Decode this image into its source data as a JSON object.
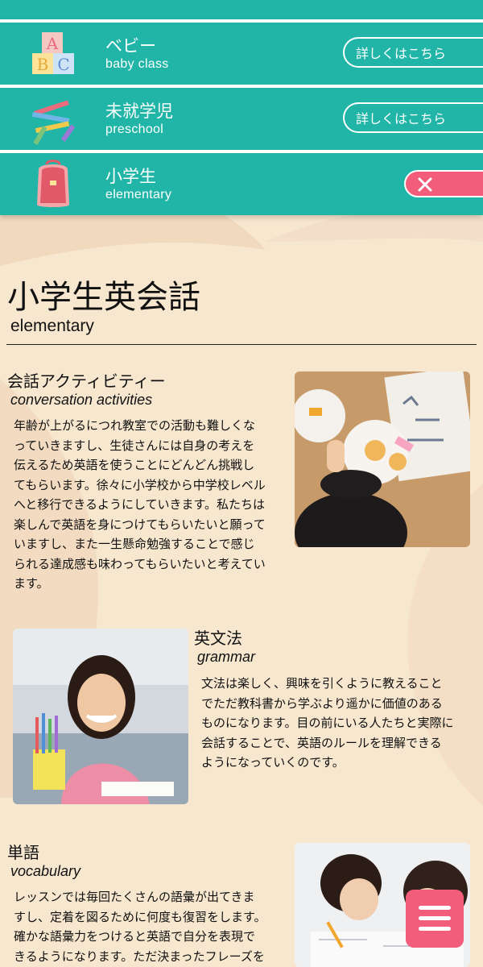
{
  "nav": {
    "items": [
      {
        "title": "ベビー",
        "subtitle": "baby class",
        "action": "詳しくはこちら"
      },
      {
        "title": "未就学児",
        "subtitle": "preschool",
        "action": "詳しくはこちら"
      },
      {
        "title": "小学生",
        "subtitle": "elementary",
        "action": "close"
      }
    ]
  },
  "page": {
    "title": "小学生英会話",
    "subtitle": "elementary"
  },
  "sections": [
    {
      "title": "会話アクティビティー",
      "subtitle": "conversation activities",
      "lines": [
        "年齢が上がるにつれ教室での活動も難しくな",
        "っていきますし、生徒さんには自身の考えを",
        "伝えるため英語を使うことにどんどん挑戦し",
        "てもらいます。徐々に小学校から中学校レベル",
        "へと移行できるようにしていきます。私たちは",
        "楽しんで英語を身につけてもらいたいと願って",
        "いますし、また一生懸命勉強することで感じ",
        "られる達成感も味わってもらいたいと考えてい",
        "ます。"
      ]
    },
    {
      "title": "英文法",
      "subtitle": "grammar",
      "lines": [
        "文法は楽しく、興味を引くように教えること",
        "でただ教科書から学ぶより遥かに価値のある",
        "ものになります。目の前にいる人たちと実際に",
        "会話することで、英語のルールを理解できる",
        "ようになっていくのです。"
      ]
    },
    {
      "title": "単語",
      "subtitle": "vocabulary",
      "lines": [
        "レッスンでは毎回たくさんの語彙が出てきま",
        "すし、定着を図るために何度も復習をします。",
        "確かな語彙力をつけると英語で自分を表現で",
        "きるようになります。ただ決まったフレーズを"
      ]
    }
  ],
  "colors": {
    "teal": "#20b5a7",
    "pink": "#f25d7c",
    "background": "#f7e7cf"
  }
}
